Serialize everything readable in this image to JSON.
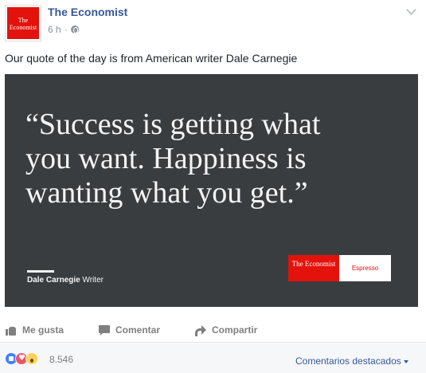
{
  "post": {
    "page_name": "The Economist",
    "avatar_logo_text": "The Economist",
    "time": "6 h",
    "separator": "·",
    "caption": "Our quote of the day is from American writer Dale Carnegie"
  },
  "image": {
    "quote_lines": [
      "“Success is getting what",
      "you want. Happiness is",
      "wanting what you get.”"
    ],
    "author_name": "Dale Carnegie",
    "author_role": "Writer",
    "brand_logo": "The Economist",
    "brand_label": "Espresso",
    "background_color": "#3a3d40",
    "brand_color": "#e3120b"
  },
  "actions": {
    "like": "Me gusta",
    "comment": "Comentar",
    "share": "Compartir"
  },
  "reactions": {
    "icons": [
      "like-reaction-icon",
      "love-reaction-icon",
      "wow-reaction-icon"
    ],
    "count": "8.546",
    "featured_comments": "Comentarios destacados"
  }
}
